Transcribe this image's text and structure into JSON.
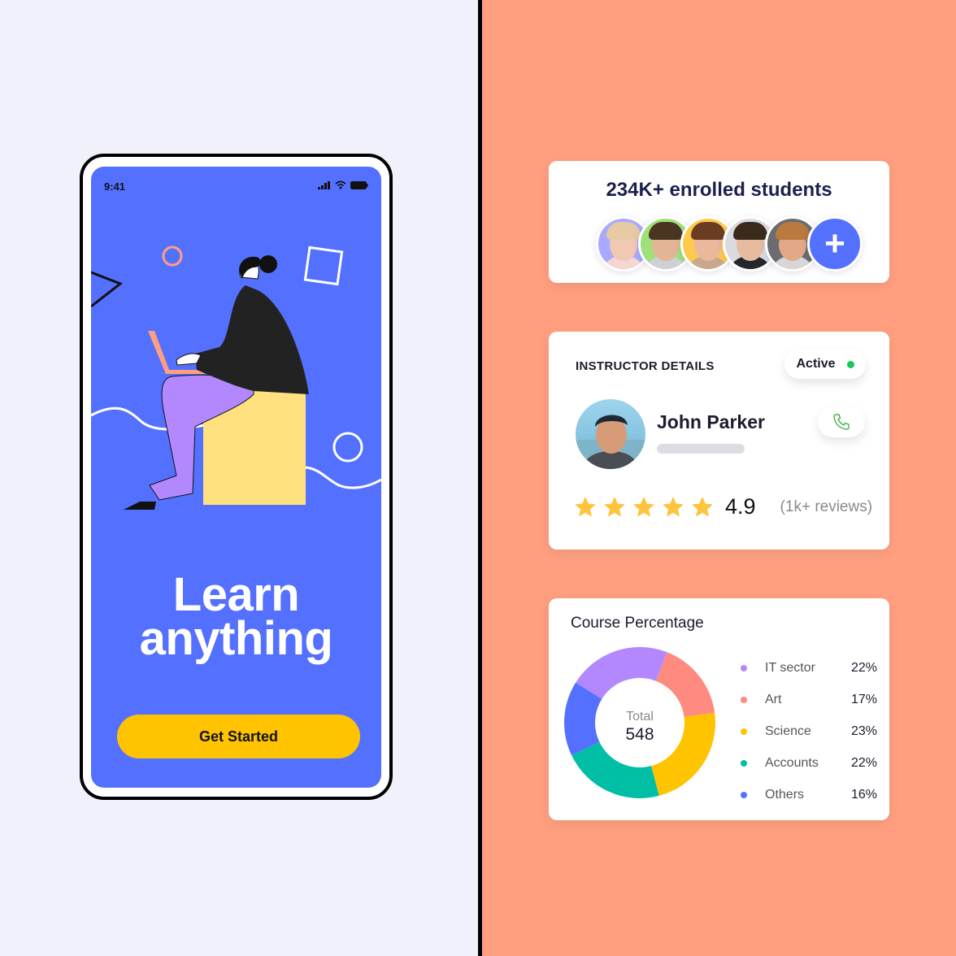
{
  "phone": {
    "status_time": "9:41",
    "headline_line1": "Learn",
    "headline_line2": "anything",
    "cta_label": "Get Started",
    "colors": {
      "screen": "#5470ff",
      "cta": "#ffc300"
    }
  },
  "students_card": {
    "title": "234K+ enrolled students",
    "avatars": [
      {
        "name": "student-1",
        "bg": "#a9a9ff",
        "hair": "#e7c9a3",
        "skin": "#f1c9b3",
        "shirt": "#f5d7d0"
      },
      {
        "name": "student-2",
        "bg": "#9fe07a",
        "hair": "#4a3422",
        "skin": "#e4b595",
        "shirt": "#cfcfd6"
      },
      {
        "name": "student-3",
        "bg": "#ffc94d",
        "hair": "#6a3d22",
        "skin": "#eab89b",
        "shirt": "#c9a890"
      },
      {
        "name": "student-4",
        "bg": "#d9dbe0",
        "hair": "#3a2a1c",
        "skin": "#e6bba0",
        "shirt": "#25272c"
      },
      {
        "name": "student-5",
        "bg": "#6a6c70",
        "hair": "#b9793f",
        "skin": "#e2a888",
        "shirt": "#d7d7d7"
      }
    ],
    "add_label": "+"
  },
  "instructor_card": {
    "label": "INSTRUCTOR DETAILS",
    "status": "Active",
    "status_color": "#16c75a",
    "name": "John Parker",
    "rating": "4.9",
    "stars": 5,
    "reviews": "(1k+ reviews)"
  },
  "course_card": {
    "title": "Course Percentage",
    "total_label": "Total",
    "total_value": "548"
  },
  "chart_data": {
    "type": "pie",
    "title": "Course Percentage",
    "center_label": "Total",
    "center_value": 548,
    "categories": [
      "IT sector",
      "Art",
      "Science",
      "Accounts",
      "Others"
    ],
    "values": [
      22,
      17,
      23,
      22,
      16
    ],
    "value_labels": [
      "22%",
      "17%",
      "23%",
      "22%",
      "16%"
    ],
    "colors": [
      "#b388ff",
      "#ff8a80",
      "#ffc400",
      "#00bfa5",
      "#5470ff"
    ],
    "legend": "right"
  }
}
